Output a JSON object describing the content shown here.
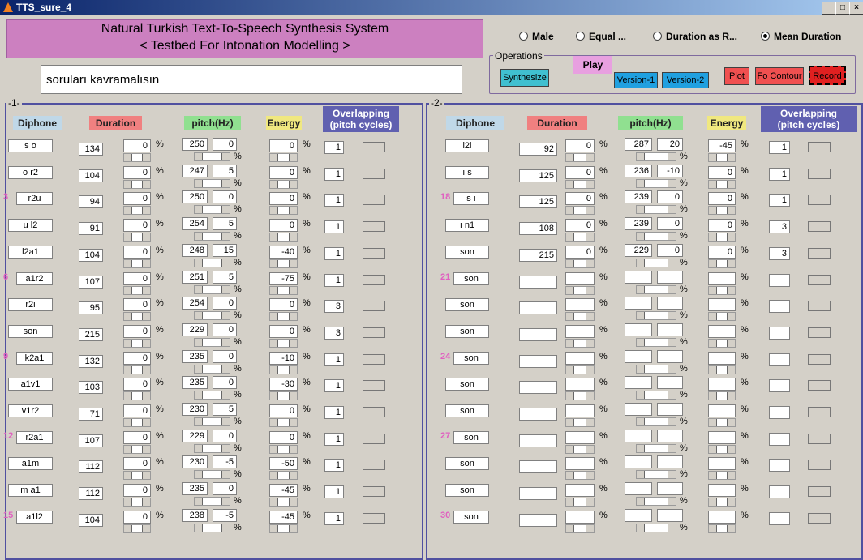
{
  "window": {
    "title": "TTS_sure_4"
  },
  "banner": {
    "line1": "Natural Turkish Text-To-Speech Synthesis System",
    "line2": "< Testbed For Intonation Modelling >"
  },
  "sentence": "soruları kavramalısın",
  "modes": [
    {
      "label": "Male",
      "selected": false
    },
    {
      "label": "Equal ...",
      "selected": false
    },
    {
      "label": "Duration as R...",
      "selected": false
    },
    {
      "label": "Mean Duration",
      "selected": true
    }
  ],
  "operations": {
    "title": "Operations",
    "synthesize": "Synthesize",
    "play": "Play",
    "version1": "Version-1",
    "version2": "Version-2",
    "plot": "Plot",
    "f0": "Fo Contour",
    "record": "Record"
  },
  "colors": {
    "diphone_hdr": "#c0d8e8",
    "duration_hdr": "#f08080",
    "pitch_hdr": "#90e090",
    "energy_hdr": "#f0e880",
    "overlap_hdr": "#6060b0",
    "synth_btn": "#40c0d0",
    "version_btn": "#20a0e0",
    "plot_btn": "#f05050",
    "record_btn": "#e02020"
  },
  "headers": {
    "diphone": "Diphone",
    "duration": "Duration",
    "pitch": "pitch(Hz)",
    "energy": "Energy",
    "overlap": "Overlapping\n(pitch cycles)",
    "pct": "%"
  },
  "panel1": {
    "title": "-1-",
    "rows": [
      {
        "dip": "s o",
        "dur": "134",
        "d": "0",
        "p1": "250",
        "p2": "0",
        "e": "0",
        "ov": "1"
      },
      {
        "dip": "o r2",
        "dur": "104",
        "d": "0",
        "p1": "247",
        "p2": "5",
        "e": "0",
        "ov": "1"
      },
      {
        "dip": "r2u",
        "dur": "94",
        "d": "0",
        "p1": "250",
        "p2": "0",
        "e": "0",
        "ov": "1",
        "idx": "3"
      },
      {
        "dip": "u l2",
        "dur": "91",
        "d": "0",
        "p1": "254",
        "p2": "5",
        "e": "0",
        "ov": "1"
      },
      {
        "dip": "l2a1",
        "dur": "104",
        "d": "0",
        "p1": "248",
        "p2": "15",
        "e": "-40",
        "ov": "1"
      },
      {
        "dip": "a1r2",
        "dur": "107",
        "d": "0",
        "p1": "251",
        "p2": "5",
        "e": "-75",
        "ov": "1",
        "idx": "6"
      },
      {
        "dip": "r2i",
        "dur": "95",
        "d": "0",
        "p1": "254",
        "p2": "0",
        "e": "0",
        "ov": "3"
      },
      {
        "dip": "son",
        "dur": "215",
        "d": "0",
        "p1": "229",
        "p2": "0",
        "e": "0",
        "ov": "3"
      },
      {
        "dip": "k2a1",
        "dur": "132",
        "d": "0",
        "p1": "235",
        "p2": "0",
        "e": "-10",
        "ov": "1",
        "idx": "9"
      },
      {
        "dip": "a1v1",
        "dur": "103",
        "d": "0",
        "p1": "235",
        "p2": "0",
        "e": "-30",
        "ov": "1"
      },
      {
        "dip": "v1r2",
        "dur": "71",
        "d": "0",
        "p1": "230",
        "p2": "5",
        "e": "0",
        "ov": "1"
      },
      {
        "dip": "r2a1",
        "dur": "107",
        "d": "0",
        "p1": "229",
        "p2": "0",
        "e": "0",
        "ov": "1",
        "idx": "12"
      },
      {
        "dip": "a1m",
        "dur": "112",
        "d": "0",
        "p1": "230",
        "p2": "-5",
        "e": "-50",
        "ov": "1"
      },
      {
        "dip": "m a1",
        "dur": "112",
        "d": "0",
        "p1": "235",
        "p2": "0",
        "e": "-45",
        "ov": "1"
      },
      {
        "dip": "a1l2",
        "dur": "104",
        "d": "0",
        "p1": "238",
        "p2": "-5",
        "e": "-45",
        "ov": "1",
        "idx": "15"
      }
    ]
  },
  "panel2": {
    "title": "-2-",
    "rows": [
      {
        "dip": "l2i",
        "dur": "92",
        "d": "0",
        "p1": "287",
        "p2": "20",
        "e": "-45",
        "ov": "1"
      },
      {
        "dip": "ı s",
        "dur": "125",
        "d": "0",
        "p1": "236",
        "p2": "-10",
        "e": "0",
        "ov": "1"
      },
      {
        "dip": "s ı",
        "dur": "125",
        "d": "0",
        "p1": "239",
        "p2": "0",
        "e": "0",
        "ov": "1",
        "idx": "18"
      },
      {
        "dip": "ı n1",
        "dur": "108",
        "d": "0",
        "p1": "239",
        "p2": "0",
        "e": "0",
        "ov": "3"
      },
      {
        "dip": "son",
        "dur": "215",
        "d": "0",
        "p1": "229",
        "p2": "0",
        "e": "0",
        "ov": "3"
      },
      {
        "dip": "son",
        "dur": "",
        "d": "",
        "p1": "",
        "p2": "",
        "e": "",
        "ov": "",
        "idx": "21"
      },
      {
        "dip": "son",
        "dur": "",
        "d": "",
        "p1": "",
        "p2": "",
        "e": "",
        "ov": ""
      },
      {
        "dip": "son",
        "dur": "",
        "d": "",
        "p1": "",
        "p2": "",
        "e": "",
        "ov": ""
      },
      {
        "dip": "son",
        "dur": "",
        "d": "",
        "p1": "",
        "p2": "",
        "e": "",
        "ov": "",
        "idx": "24"
      },
      {
        "dip": "son",
        "dur": "",
        "d": "",
        "p1": "",
        "p2": "",
        "e": "",
        "ov": ""
      },
      {
        "dip": "son",
        "dur": "",
        "d": "",
        "p1": "",
        "p2": "",
        "e": "",
        "ov": ""
      },
      {
        "dip": "son",
        "dur": "",
        "d": "",
        "p1": "",
        "p2": "",
        "e": "",
        "ov": "",
        "idx": "27"
      },
      {
        "dip": "son",
        "dur": "",
        "d": "",
        "p1": "",
        "p2": "",
        "e": "",
        "ov": ""
      },
      {
        "dip": "son",
        "dur": "",
        "d": "",
        "p1": "",
        "p2": "",
        "e": "",
        "ov": ""
      },
      {
        "dip": "son",
        "dur": "",
        "d": "",
        "p1": "",
        "p2": "",
        "e": "",
        "ov": "",
        "idx": "30"
      }
    ]
  }
}
